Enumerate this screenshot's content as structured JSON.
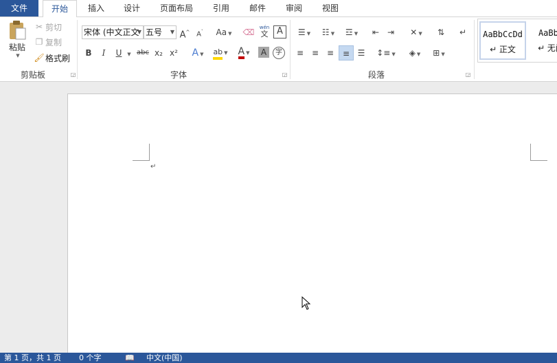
{
  "tabs": [
    {
      "label": "文件"
    },
    {
      "label": "开始"
    },
    {
      "label": "插入"
    },
    {
      "label": "设计"
    },
    {
      "label": "页面布局"
    },
    {
      "label": "引用"
    },
    {
      "label": "邮件"
    },
    {
      "label": "审阅"
    },
    {
      "label": "视图"
    }
  ],
  "clipboard": {
    "paste": "粘贴",
    "cut": "剪切",
    "copy": "复制",
    "format_painter": "格式刷",
    "group_label": "剪贴板"
  },
  "font": {
    "font_name": "宋体 (中文正文",
    "font_size": "五号",
    "change_case": "Aa",
    "phonetic_top": "wén",
    "phonetic_bottom": "文",
    "char_border": "A",
    "bold": "B",
    "italic": "I",
    "underline": "U",
    "strike": "abc",
    "subscript": "x₂",
    "superscript": "x²",
    "enclose": "字",
    "group_label": "字体"
  },
  "paragraph": {
    "group_label": "段落"
  },
  "styles": {
    "items": [
      {
        "sample": "AaBbCcDd",
        "name": "↵ 正文"
      },
      {
        "sample": "AaBbC",
        "name": "↵ 无间"
      }
    ]
  },
  "document": {
    "paragraph_mark": "↵"
  },
  "status": {
    "page": "第 1 页，共 1 页",
    "words": "0 个字",
    "language": "中文(中国)"
  },
  "colors": {
    "accent": "#2b579a",
    "highlight": "#ffd800",
    "font_color": "#c00000"
  }
}
